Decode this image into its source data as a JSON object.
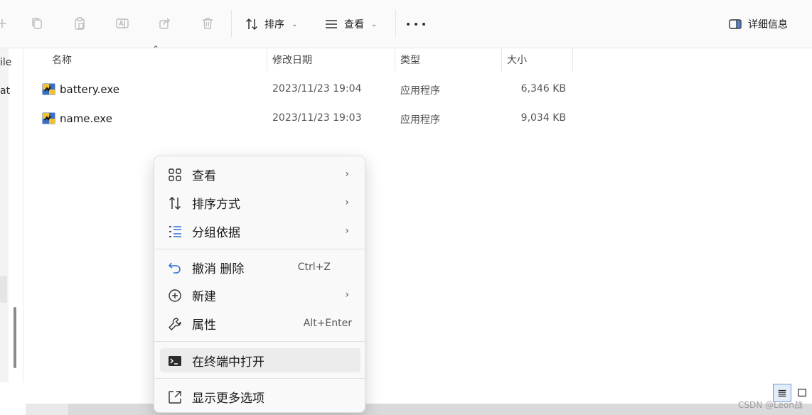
{
  "toolbar": {
    "sort_label": "排序",
    "view_label": "查看",
    "details_label": "详细信息",
    "icons": [
      "new-icon",
      "copy-icon",
      "paste-icon",
      "rename-icon",
      "share-icon",
      "delete-icon"
    ]
  },
  "left_nav": {
    "partial_text_1": "ile",
    "partial_text_2": "at"
  },
  "columns": {
    "name": "名称",
    "date": "修改日期",
    "type": "类型",
    "size": "大小"
  },
  "files": [
    {
      "name": "battery.exe",
      "date": "2023/11/23 19:04",
      "type": "应用程序",
      "size": "6,346 KB"
    },
    {
      "name": "name.exe",
      "date": "2023/11/23 19:03",
      "type": "应用程序",
      "size": "9,034 KB"
    }
  ],
  "context_menu": {
    "items": [
      {
        "label": "查看",
        "icon": "grid-icon",
        "submenu": true
      },
      {
        "label": "排序方式",
        "icon": "sort-icon",
        "submenu": true
      },
      {
        "label": "分组依据",
        "icon": "group-icon",
        "submenu": true
      },
      {
        "label": "撤消 删除",
        "icon": "undo-icon",
        "shortcut": "Ctrl+Z"
      },
      {
        "label": "新建",
        "icon": "new-plus-icon",
        "submenu": true
      },
      {
        "label": "属性",
        "icon": "wrench-icon",
        "shortcut": "Alt+Enter"
      },
      {
        "label": "在终端中打开",
        "icon": "terminal-icon",
        "highlighted": true
      },
      {
        "label": "显示更多选项",
        "icon": "more-options-icon"
      }
    ]
  },
  "watermark": "CSDN @Leon战"
}
